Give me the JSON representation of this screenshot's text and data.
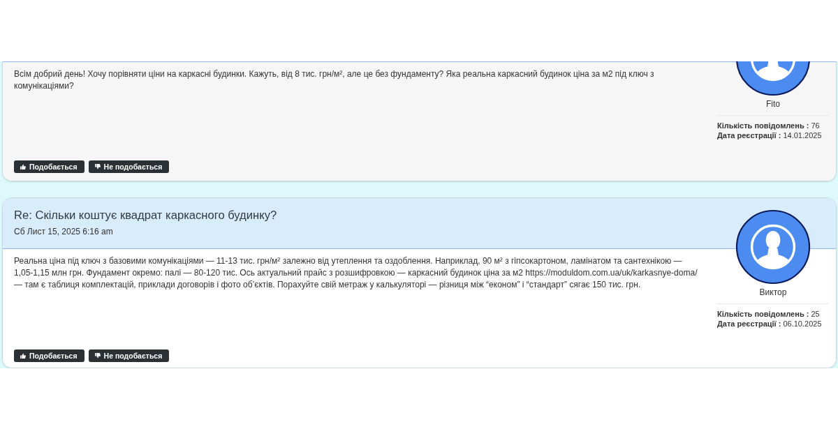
{
  "posts": [
    {
      "kind": "cut_off",
      "body": "Всім добрий день! Хочу порівняти ціни на каркасні будинки. Кажуть, від 8 тис. грн/м², але це без фундаменту? Яка реальна каркасний будинок ціна за м2 під ключ з комунікаціями?",
      "reactions": [
        {
          "kind": "like",
          "label": "Подобається"
        },
        {
          "kind": "dislike",
          "label": "Не подобається"
        }
      ],
      "author": {
        "name": "Fito",
        "stats": [
          "**Кількість повідомлень :** 76",
          "**Дата реєстрації :** 14.01.2025"
        ]
      }
    },
    {
      "kind": "full",
      "title": "Re: Скільки коштує квадрат каркасного будинку?",
      "date": "Сб Лист 15, 2025 6:16 am",
      "body": "Реальна ціна під ключ з базовими комунікаціями — 11-13 тис. грн/м² залежно від утеплення та оздоблення. Наприклад, 90 м² з гіпсокартоном, ламінатом та сантехнікою — 1,05-1,15 млн грн. Фундамент окремо: палі — 80-120 тис. Ось актуальний прайс з розшифровкою — каркасний будинок ціна за м2 https://moduldom.com.ua/uk/karkasnye-doma/ — там є таблиця комплектацій, приклади договорів і фото об’єктів. Порахуйте свій метраж у калькуляторі — різниця між “економ” і “стандарт” сягає 150 тис. грн.",
      "reactions": [
        {
          "kind": "like",
          "label": "Подобається"
        },
        {
          "kind": "dislike",
          "label": "Не подобається"
        }
      ],
      "author": {
        "name": "Виктор",
        "stats": [
          "**Кількість повідомлень :** 25",
          "**Дата реєстрації :** 06.10.2025"
        ]
      }
    }
  ]
}
